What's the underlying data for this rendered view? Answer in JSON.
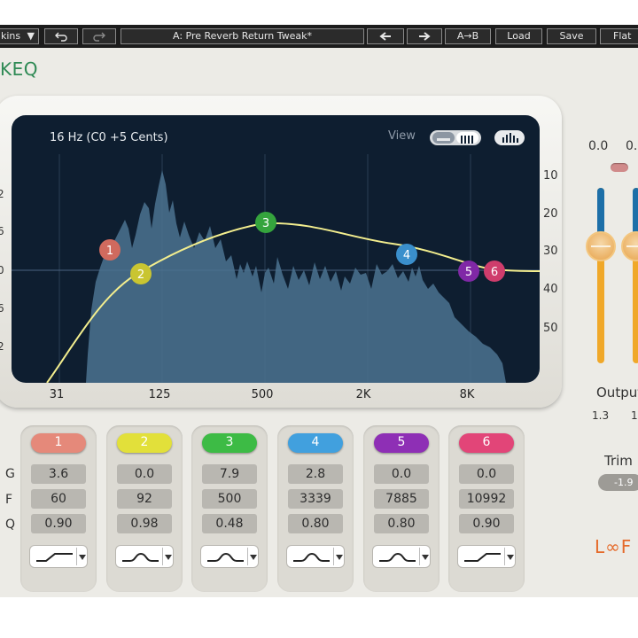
{
  "toolbar": {
    "preset_menu_label": "kins",
    "undo_icon": "undo-icon",
    "redo_icon": "redo-icon",
    "preset_name": "A: Pre Reverb Return Tweak*",
    "prev_icon": "arrow-left-icon",
    "next_icon": "arrow-right-icon",
    "ab_label": "A→B",
    "load_label": "Load",
    "save_label": "Save",
    "flat_label": "Flat"
  },
  "plugin": {
    "title": "EQ",
    "brand": "L∞F"
  },
  "graph": {
    "freq_readout": "16 Hz (C0 +5 Cents)",
    "view_label": "View",
    "left_ticks": [
      "2",
      "6",
      "0",
      "6",
      "2"
    ],
    "right_ticks": [
      "10",
      "20",
      "30",
      "40",
      "50"
    ],
    "freq_ticks": [
      "31",
      "125",
      "500",
      "2K",
      "8K"
    ],
    "curve_color": "#f3ee8e",
    "spectrum_color": "#4b7390"
  },
  "bands": [
    {
      "number": "1",
      "color": "#e5897a",
      "gain": "3.6",
      "freq": "60",
      "q": "0.90",
      "shape": "low-shelf-icon"
    },
    {
      "number": "2",
      "color": "#e2e03a",
      "gain": "0.0",
      "freq": "92",
      "q": "0.98",
      "shape": "bell-icon"
    },
    {
      "number": "3",
      "color": "#3dbb45",
      "gain": "7.9",
      "freq": "500",
      "q": "0.48",
      "shape": "bell-icon"
    },
    {
      "number": "4",
      "color": "#41a0de",
      "gain": "2.8",
      "freq": "3339",
      "q": "0.80",
      "shape": "bell-icon"
    },
    {
      "number": "5",
      "color": "#8e2fb5",
      "gain": "0.0",
      "freq": "7885",
      "q": "0.80",
      "shape": "bell-icon"
    },
    {
      "number": "6",
      "color": "#e24578",
      "gain": "0.0",
      "freq": "10992",
      "q": "0.90",
      "shape": "high-shelf-icon"
    }
  ],
  "row_labels": {
    "gain": "G",
    "freq": "F",
    "q": "Q"
  },
  "output": {
    "label": "Output",
    "top_left": "0.0",
    "top_right": "0.",
    "bottom_left": "1.3",
    "bottom_right": "1"
  },
  "trim": {
    "label": "Trim",
    "value": "-1.9"
  }
}
